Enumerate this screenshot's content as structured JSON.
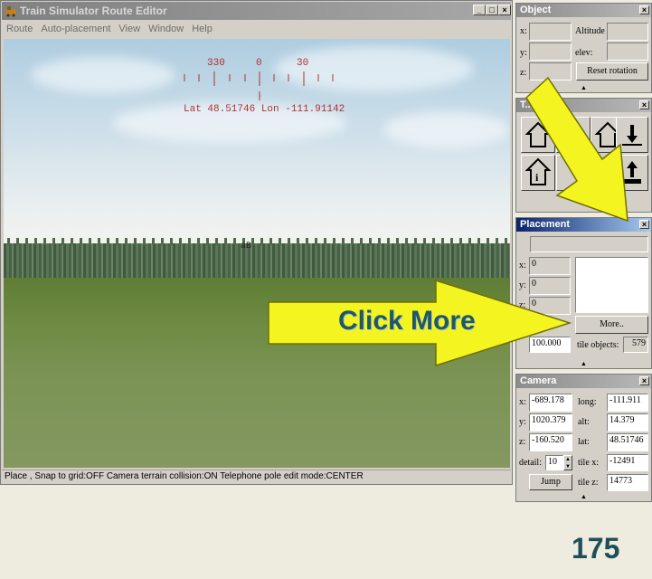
{
  "window": {
    "title": "Train Simulator Route Editor",
    "controls": [
      "_",
      "□",
      "×"
    ]
  },
  "menu": [
    "Route",
    "Auto-placement",
    "View",
    "Window",
    "Help"
  ],
  "compass": {
    "ticks": [
      "330",
      "0",
      "30"
    ],
    "position": "Lat 48.51746 Lon -111.91142"
  },
  "viewport": {
    "crosshair_label": "aB"
  },
  "status_text": "Place , Snap to grid:OFF Camera terrain collision:ON Telephone pole edit mode:CENTER",
  "object_panel": {
    "title": "Object",
    "x_label": "x:",
    "y_label": "y:",
    "z_label": "z:",
    "altitude_label": "Altitude",
    "elev_label": "elev:",
    "reset_button": "Reset rotation"
  },
  "tools_panel": {
    "title": "T..."
  },
  "placement_panel": {
    "title": "Placement",
    "x_label": "x:",
    "x_value": "0",
    "y_label": "y:",
    "y_value": "0",
    "z_label": "z:",
    "z_value": "0",
    "more_button": "More..",
    "distance_value": "100.000",
    "tile_objects_label": "tile objects:",
    "tile_objects_value": "579"
  },
  "camera_panel": {
    "title": "Camera",
    "x_label": "x:",
    "x_value": "-689.178",
    "y_label": "y:",
    "y_value": "1020.379",
    "z_label": "z:",
    "z_value": "-160.520",
    "long_label": "long:",
    "long_value": "-111.911",
    "alt_label": "alt:",
    "alt_value": "14.379",
    "lat_label": "lat:",
    "lat_value": "48.51746",
    "tilex_label": "tile x:",
    "tilex_value": "-12491",
    "tilez_label": "tile z:",
    "tilez_value": "14773",
    "detail_label": "detail:",
    "detail_value": "10",
    "jump_button": "Jump"
  },
  "callout_text": "Click More",
  "page_number": "175",
  "colors": {
    "arrow_fill": "#f4f420",
    "callout_text": "#1f5a64",
    "page_number": "#1e4f58",
    "active_title": "#0a246a"
  }
}
